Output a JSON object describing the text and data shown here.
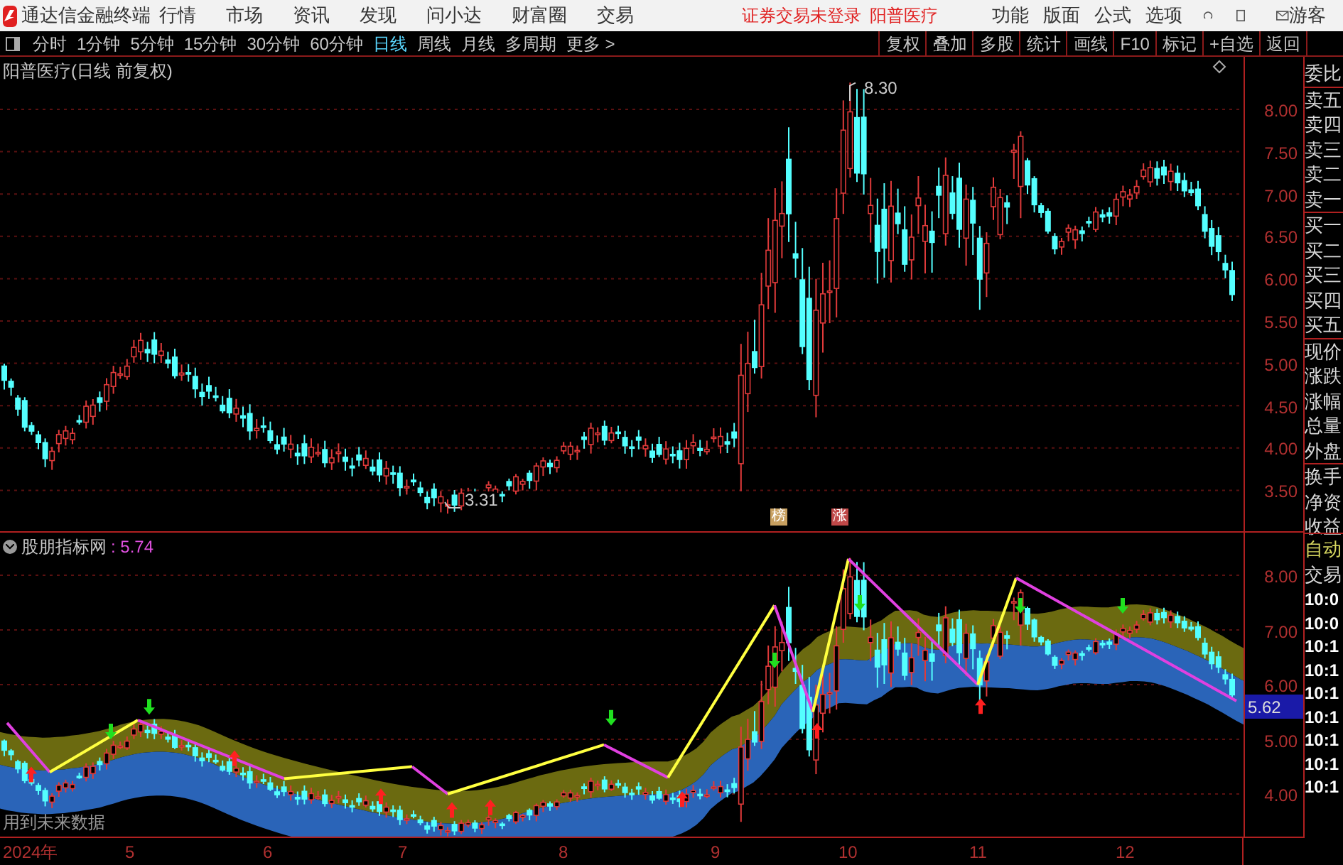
{
  "app_bar": {
    "title": "通达信金融终端",
    "menus": [
      "行情",
      "市场",
      "资讯",
      "发现",
      "问小达",
      "财富圈",
      "交易"
    ],
    "notice": "证券交易未登录",
    "stock": "阳普医疗",
    "tools": [
      "功能",
      "版面",
      "公式",
      "选项"
    ],
    "user": "游客"
  },
  "periods": [
    {
      "label": "分时",
      "selected": false
    },
    {
      "label": "1分钟",
      "selected": false
    },
    {
      "label": "5分钟",
      "selected": false
    },
    {
      "label": "15分钟",
      "selected": false
    },
    {
      "label": "30分钟",
      "selected": false
    },
    {
      "label": "60分钟",
      "selected": false
    },
    {
      "label": "日线",
      "selected": true
    },
    {
      "label": "周线",
      "selected": false
    },
    {
      "label": "月线",
      "selected": false
    },
    {
      "label": "多周期",
      "selected": false
    },
    {
      "label": "更多 >",
      "selected": false
    }
  ],
  "actions": [
    "复权",
    "叠加",
    "多股",
    "统计",
    "画线",
    "F10",
    "标记",
    "+自选",
    "返回"
  ],
  "main_chart": {
    "title": "阳普医疗(日线 前复权)",
    "yticks": [
      "8.00",
      "7.50",
      "7.00",
      "6.50",
      "6.00",
      "5.50",
      "5.00",
      "4.50",
      "4.00",
      "3.50"
    ],
    "high_label": "8.30",
    "low_label": "3.31",
    "markers": [
      {
        "text": "榜",
        "color": "#c8a060"
      },
      {
        "text": "涨",
        "color": "#c04848"
      }
    ]
  },
  "indicator": {
    "name": "股朋指标网",
    "value": ": 5.74",
    "yticks": [
      "8.00",
      "7.00",
      "6.00",
      "5.00",
      "4.00"
    ],
    "price_tag": "5.62",
    "note": "用到未来数据"
  },
  "dates": [
    "2024年",
    "5",
    "6",
    "7",
    "8",
    "9",
    "10",
    "11",
    "12"
  ],
  "quote_panel": {
    "groups": [
      [
        "委比"
      ],
      [
        "卖五",
        "卖四",
        "卖三",
        "卖二",
        "卖一"
      ],
      [
        "买一",
        "买二",
        "买三",
        "买四",
        "买五"
      ],
      [
        "现价",
        "涨跌",
        "涨幅",
        "总量",
        "外盘"
      ],
      [
        "换手",
        "净资",
        "收益"
      ]
    ],
    "auto": "自动",
    "trade": "交易",
    "times": [
      "10:0",
      "10:0",
      "10:1",
      "10:1",
      "10:1",
      "10:1",
      "10:1",
      "10:1",
      "10:1"
    ]
  }
}
